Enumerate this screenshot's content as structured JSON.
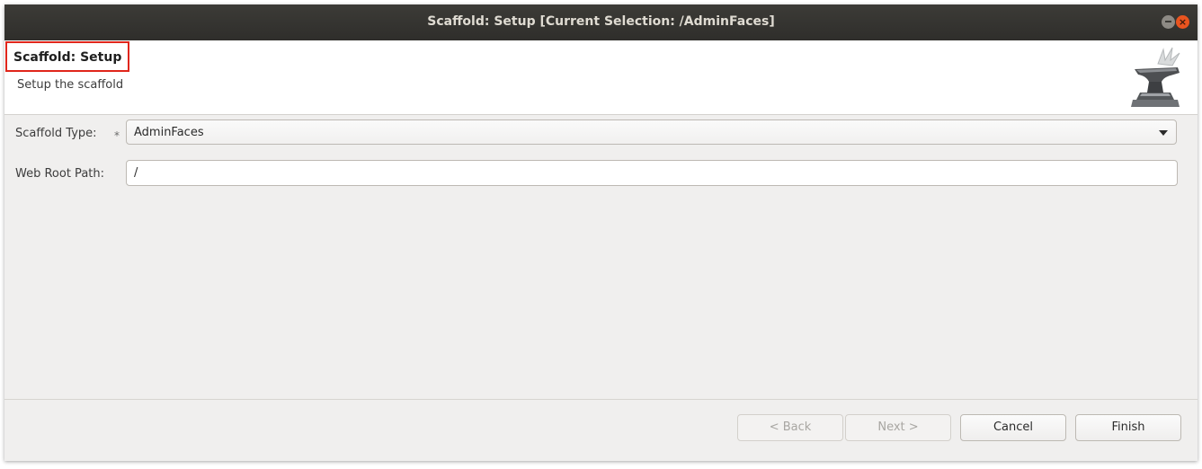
{
  "window": {
    "title": "Scaffold: Setup [Current Selection: /AdminFaces]",
    "close_glyph": "×"
  },
  "header": {
    "title": "Scaffold: Setup",
    "description": "Setup the scaffold",
    "logo_icon": "anvil-icon"
  },
  "form": {
    "scaffold_type": {
      "label": "Scaffold Type:",
      "required_marker": "*",
      "value": "AdminFaces"
    },
    "web_root_path": {
      "label": "Web Root Path:",
      "value": "/"
    }
  },
  "buttons": {
    "back": {
      "label": "< Back",
      "enabled": false
    },
    "next": {
      "label": "Next >",
      "enabled": false
    },
    "cancel": {
      "label": "Cancel",
      "enabled": true
    },
    "finish": {
      "label": "Finish",
      "enabled": true
    }
  },
  "colors": {
    "title_highlight_border": "#e0261b",
    "titlebar": "#3c3b37",
    "close_button": "#e9541f"
  }
}
